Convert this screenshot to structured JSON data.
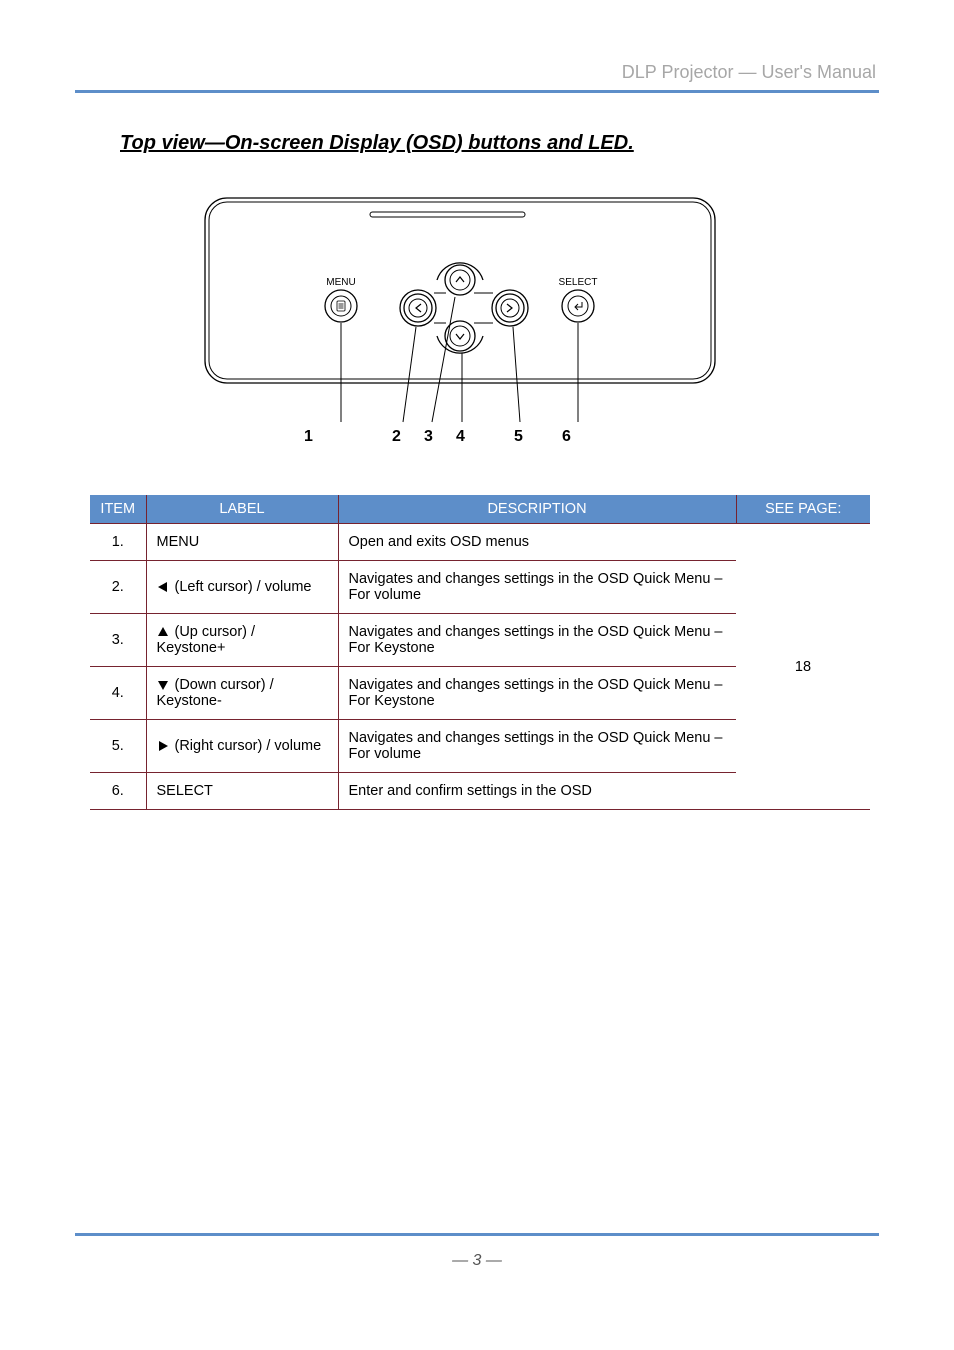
{
  "header": {
    "brand": "DLP Projector — User's Manual"
  },
  "section": {
    "title": "Top view—On-screen Display (OSD) buttons and LED."
  },
  "diagram": {
    "labels": {
      "menu": "MENU",
      "select": "SELECT"
    },
    "numbers": [
      "1",
      "2",
      "3",
      "4",
      "5",
      "6"
    ]
  },
  "table": {
    "headers": {
      "item": "ITEM",
      "label": "LABEL",
      "desc": "DESCRIPTION",
      "page": "SEE PAGE:"
    },
    "rows": [
      {
        "item": "1.",
        "label": "MENU",
        "desc": "Open and exits OSD menus"
      },
      {
        "item": "2.",
        "symbol": "left",
        "label": "(Left cursor) / volume",
        "desc": "Navigates and changes settings in the OSD Quick Menu – For volume"
      },
      {
        "item": "3.",
        "symbol": "up",
        "label": "(Up cursor) / Keystone+",
        "desc": "Navigates and changes settings in the OSD Quick Menu – For Keystone"
      },
      {
        "item": "4.",
        "symbol": "down",
        "label": "(Down cursor) / Keystone-",
        "desc": "Navigates and changes settings in the OSD Quick Menu – For Keystone"
      },
      {
        "item": "5.",
        "symbol": "right",
        "label": "(Right cursor) / volume",
        "desc": "Navigates and changes settings in the OSD Quick Menu – For volume"
      },
      {
        "item": "6.",
        "label": "SELECT",
        "desc": "Enter and confirm settings in the OSD"
      }
    ],
    "see_page": "18"
  },
  "footer": {
    "page": "— 3 —"
  }
}
